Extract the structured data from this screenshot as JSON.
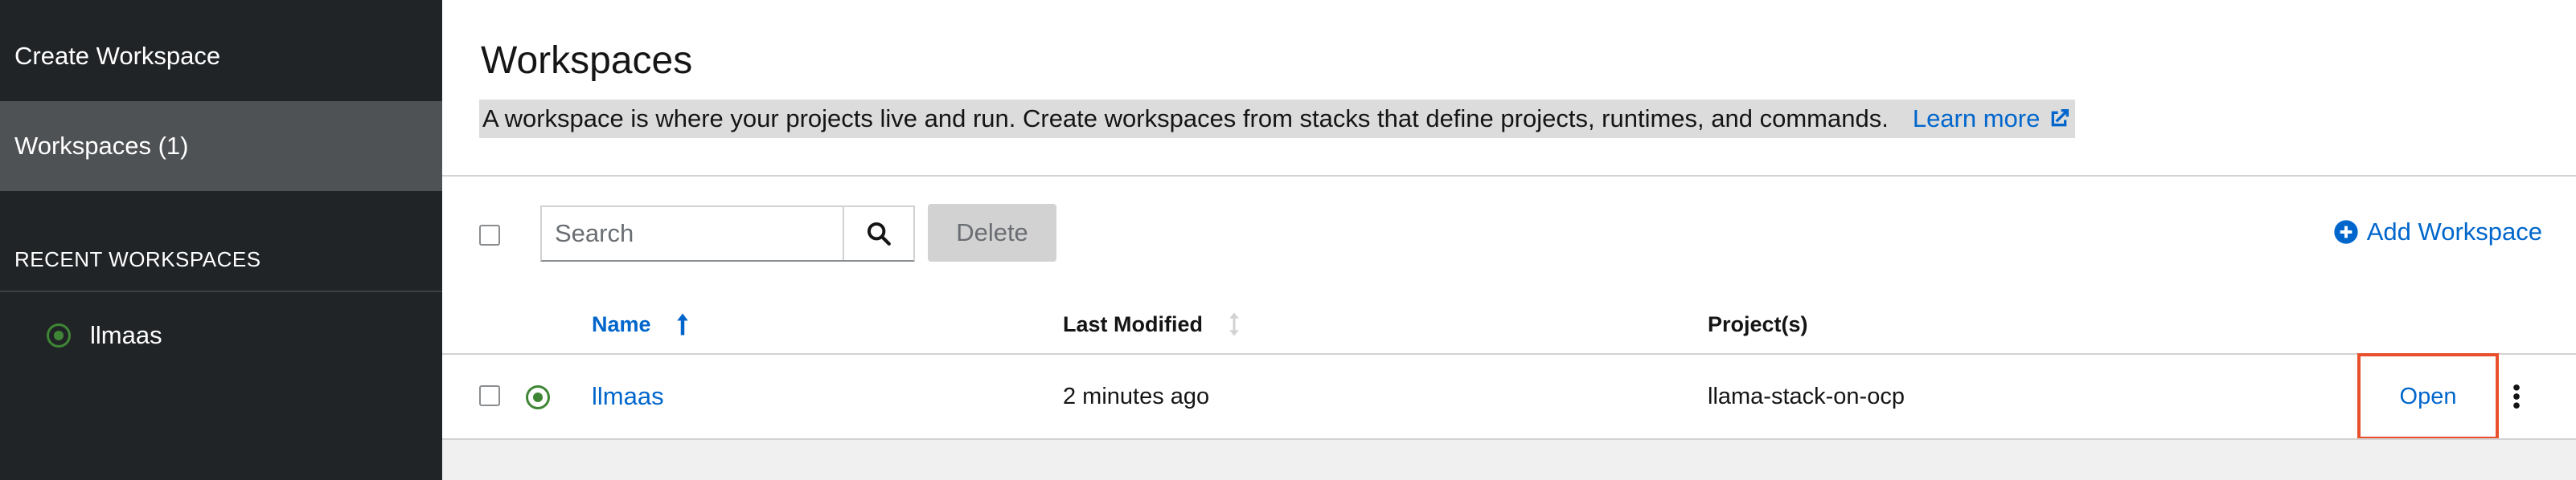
{
  "sidebar": {
    "create_label": "Create Workspace",
    "workspaces_label": "Workspaces (1)",
    "recent_section_label": "RECENT WORKSPACES",
    "recent_items": [
      {
        "label": "llmaas",
        "status": "running",
        "status_color": "#3e8635"
      }
    ]
  },
  "header": {
    "title": "Workspaces",
    "description": "A workspace is where your projects live and run. Create workspaces from stacks that define projects, runtimes, and commands.",
    "learn_more": "Learn more",
    "learn_more_icon": "external-link-icon"
  },
  "toolbar": {
    "search_placeholder": "Search",
    "search_value": "",
    "search_icon": "search-icon",
    "delete_label": "Delete",
    "add_label": "Add Workspace",
    "add_icon": "plus-circle-icon"
  },
  "table": {
    "columns": [
      {
        "label": "Name",
        "sort": "ascending"
      },
      {
        "label": "Last Modified",
        "sort": "unsorted"
      },
      {
        "label": "Project(s)"
      }
    ],
    "rows": [
      {
        "name": "llmaas",
        "status": "running",
        "last_modified": "2 minutes ago",
        "projects": "llama-stack-on-ocp",
        "action_label": "Open",
        "actions_icon": "kebab-icon"
      }
    ]
  },
  "colors": {
    "sidebar_bg": "#212427",
    "sidebar_active": "#4f5255",
    "link": "#0066cc",
    "status_running": "#3e8635",
    "highlight_box": "#e7502b"
  }
}
